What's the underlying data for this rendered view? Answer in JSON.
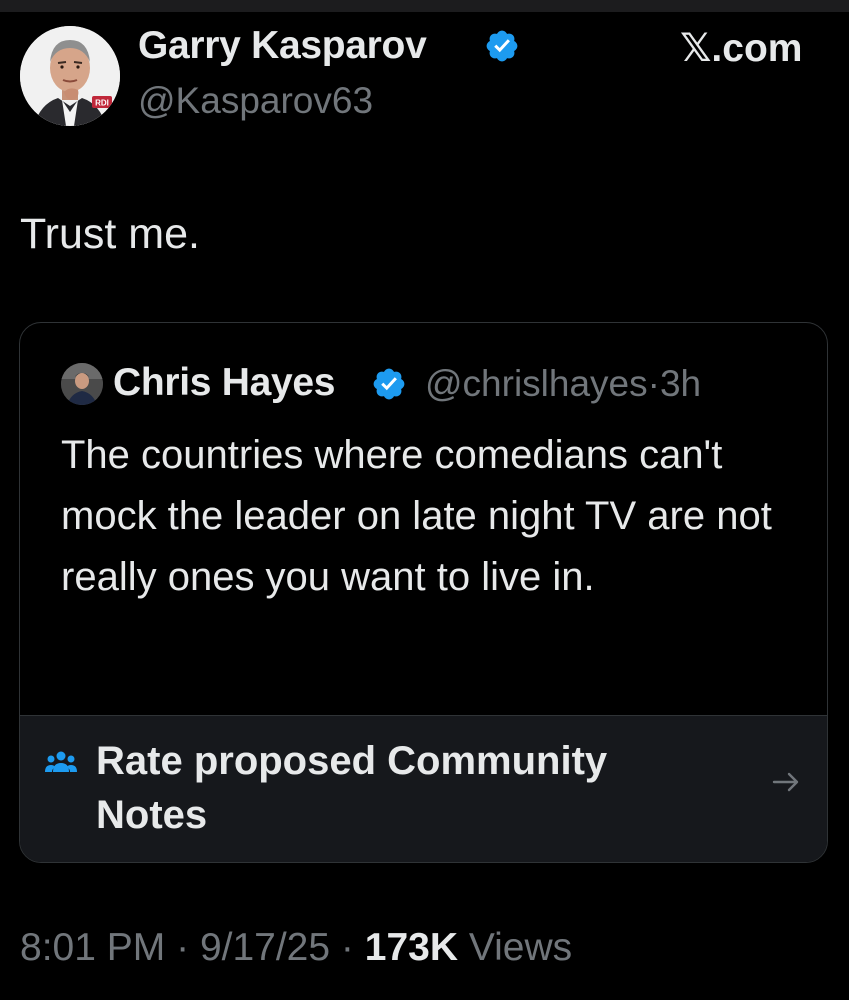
{
  "author": {
    "name": "Garry Kasparov",
    "handle": "@Kasparov63",
    "avatar_badge_text": "RDI"
  },
  "brand": "𝕏.com",
  "tweet": {
    "text": "Trust me."
  },
  "quote": {
    "name": "Chris Hayes",
    "handle": "@chrislhayes",
    "separator": "·",
    "time": "3h",
    "text": "The countries where comedians can't mock the leader on late night TV are not really ones you want to live in."
  },
  "community_notes": {
    "label": "Rate proposed Community Notes",
    "icon": "people-icon",
    "arrow_icon": "arrow-right-icon"
  },
  "footer": {
    "time": "8:01 PM",
    "separator": "·",
    "date": "9/17/25",
    "views_count": "173K",
    "views_label": "Views"
  },
  "colors": {
    "background": "#000000",
    "text": "#e7e9ea",
    "secondary": "#71767b",
    "verified": "#1d9bf0",
    "community_icon": "#1d9bf0",
    "border": "#2f3336"
  }
}
